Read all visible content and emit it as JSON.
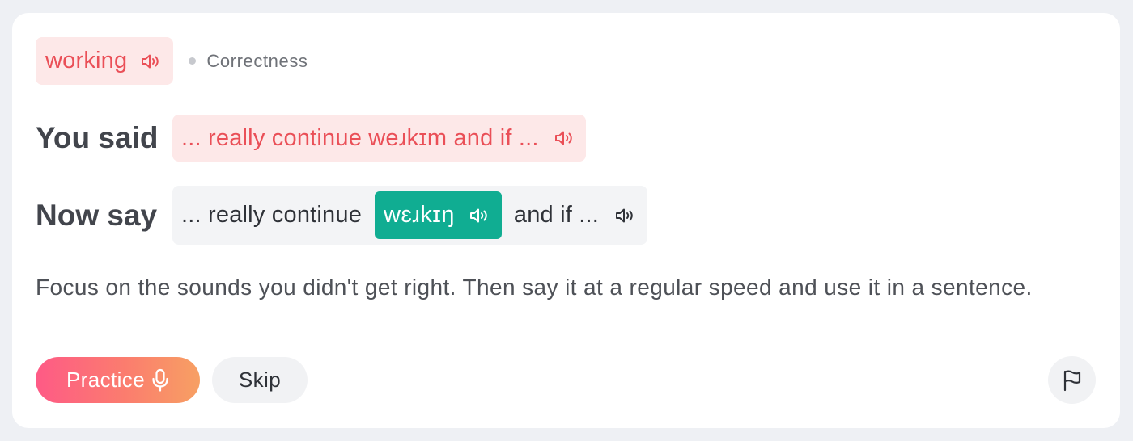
{
  "target": {
    "word": "working",
    "category": "Correctness",
    "speaker_icon": "speaker-icon"
  },
  "you_said": {
    "label": "You said",
    "text": "... really continue weɹkɪm and if ..."
  },
  "now_say": {
    "label": "Now say",
    "before": "... really continue",
    "ipa": "wɛɹkɪŋ",
    "after": "and if ..."
  },
  "instruction": "Focus on the sounds you didn't get right. Then say it at a regular speed and use it in a sentence.",
  "actions": {
    "practice_label": "Practice",
    "practice_icon": "microphone-icon",
    "skip_label": "Skip",
    "flag_icon": "flag-icon"
  },
  "colors": {
    "error_text": "#ea4f57",
    "error_bg": "#fde8e8",
    "correct_bg": "#10ad92",
    "practice_gradient_start": "#fe5a86",
    "practice_gradient_end": "#f7a063"
  }
}
